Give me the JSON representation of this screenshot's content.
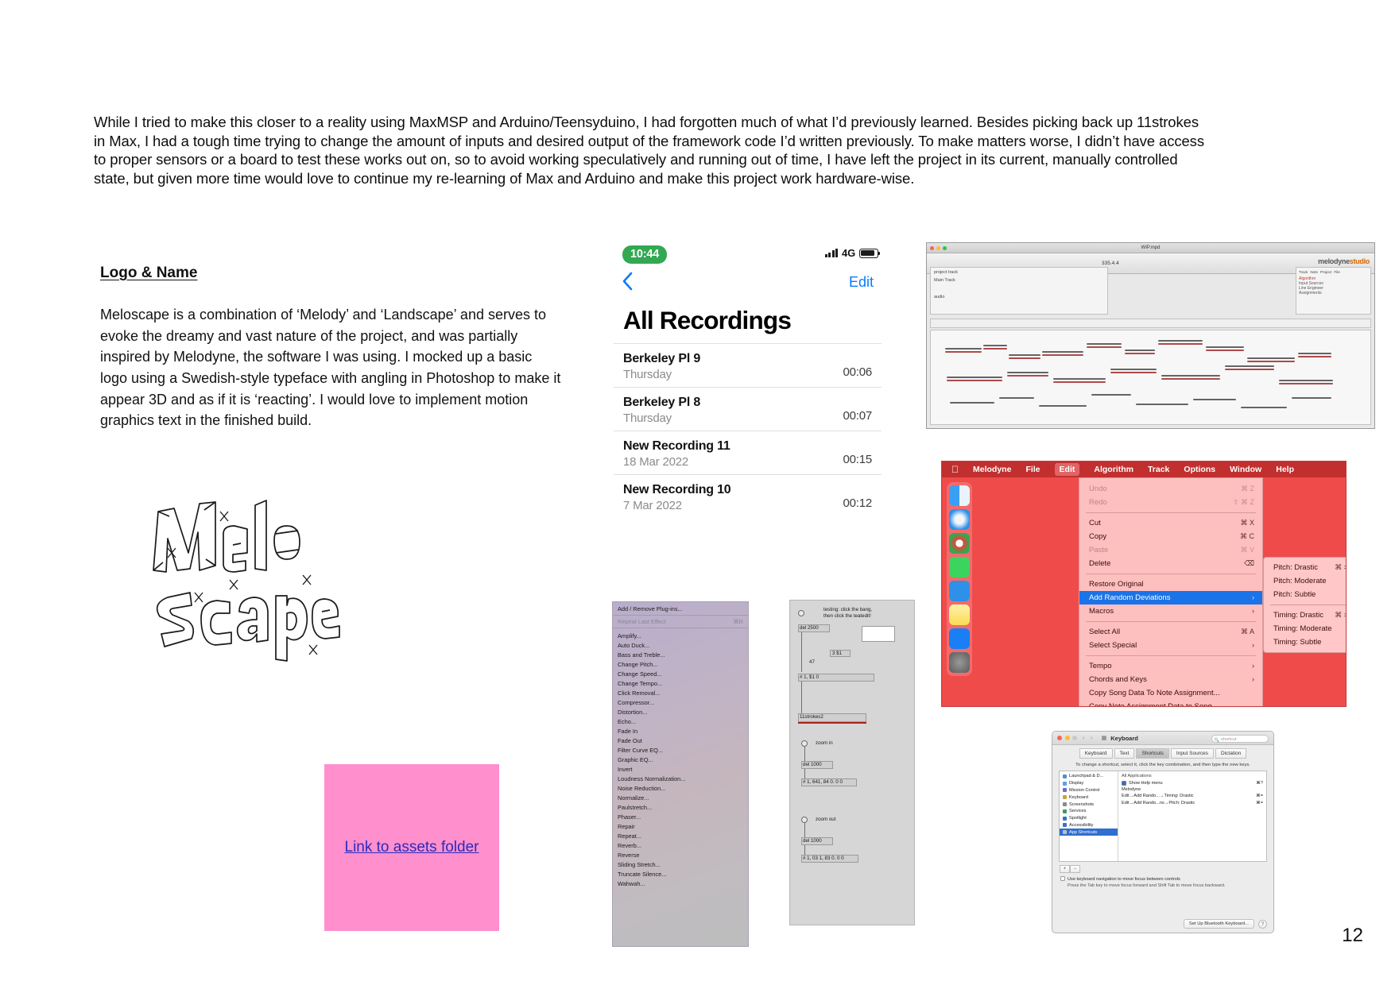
{
  "document": {
    "page_number": "12",
    "intro_paragraph": "While I tried to make this closer to a reality using MaxMSP and Arduino/Teensyduino, I had forgotten much of what I’d previously learned. Besides picking back up 11strokes in Max, I had a tough time trying to change the amount of inputs and desired output of the framework code I’d written previously. To make matters worse, I didn’t have access to proper sensors or a board to test these works out on, so to avoid working speculatively and running out of time, I have left the project in its current, manually controlled state, but given more time would love to continue my re-learning of Max and Arduino and make this project work hardware-wise."
  },
  "logo_section": {
    "heading": "Logo & Name",
    "body": "Meloscape is a combination of ‘Melody’ and ‘Landscape’ and serves to evoke the dreamy and vast nature of the project, and was partially inspired by Melodyne, the software I was using. I mocked up a basic logo using a Swedish-style typeface with angling in Photoshop to make it appear 3D and as if it is ‘reacting’. I would love to implement motion graphics text in the finished build.",
    "logo_wordmark_line1": "Melo",
    "logo_wordmark_line2": "Scape"
  },
  "assets_link": {
    "label_line1": "Link to assets",
    "label_line2": "folder",
    "background_color": "#ff8fcd",
    "text_color": "#2b2bbd"
  },
  "voice_memos": {
    "status": {
      "time": "10:44",
      "time_pill_color": "#33a852",
      "network": "4G"
    },
    "nav": {
      "back_icon": "chevron-left-icon",
      "edit_label": "Edit",
      "accent_color": "#0a7aff"
    },
    "title": "All Recordings",
    "recordings": [
      {
        "name": "Berkeley Pl 9",
        "date": "Thursday",
        "duration": "00:06"
      },
      {
        "name": "Berkeley Pl 8",
        "date": "Thursday",
        "duration": "00:07"
      },
      {
        "name": "New Recording 11",
        "date": "18 Mar 2022",
        "duration": "00:15"
      },
      {
        "name": "New Recording 10",
        "date": "7 Mar 2022",
        "duration": "00:12"
      }
    ]
  },
  "audacity_effects": {
    "header": "Add / Remove Plug-ins...",
    "repeat_item": "Repeat Last Effect",
    "repeat_shortcut": "⌘R",
    "items": [
      "Amplify...",
      "Auto Duck...",
      "Bass and Treble...",
      "Change Pitch...",
      "Change Speed...",
      "Change Tempo...",
      "Click Removal...",
      "Compressor...",
      "Distortion...",
      "Echo...",
      "Fade In",
      "Fade Out",
      "Filter Curve EQ...",
      "Graphic EQ...",
      "Invert",
      "Loudness Normalization...",
      "Noise Reduction...",
      "Normalize...",
      "Paulstretch...",
      "Phaser...",
      "Repair",
      "Repeat...",
      "Reverb...",
      "Reverse",
      "Sliding Stretch...",
      "Truncate Silence...",
      "Wahwah..."
    ]
  },
  "max_patch": {
    "comment_line1": "testing: click the bang,",
    "comment_line2": "then click the teatedit!",
    "objects": [
      "del 2500",
      "3 $1",
      "47",
      "# 1, $1 0",
      "11strokes2",
      "zoom in",
      "del 1000",
      "# 1, 641, 84 0. 0 0",
      "zoom out",
      "del 1000",
      "# 1, 03 1, 83 0. 0 0"
    ]
  },
  "melodyne_editor": {
    "window_title": "WIP.mpd",
    "brand": "melodyne",
    "brand_suffix": "studio",
    "tempo_value": "335.4.4",
    "panel_tabs": [
      "Track",
      "Note",
      "Project",
      "File"
    ],
    "left_labels": [
      "project track",
      "Main Track",
      "audio"
    ],
    "right_labels": [
      "Algorithm",
      "Input Sources",
      "Line Engineer",
      "Assignments"
    ]
  },
  "melodyne_menu": {
    "menubar": [
      "Melodyne",
      "File",
      "Edit",
      "Algorithm",
      "Track",
      "Options",
      "Window",
      "Help"
    ],
    "active_menu": "Edit",
    "apple_icon": "apple-logo-icon",
    "items": [
      {
        "label": "Undo",
        "shortcut": "⌘ Z",
        "state": "disabled"
      },
      {
        "label": "Redo",
        "shortcut": "⇧ ⌘ Z",
        "state": "disabled"
      },
      {
        "sep": true
      },
      {
        "label": "Cut",
        "shortcut": "⌘ X",
        "state": "normal"
      },
      {
        "label": "Copy",
        "shortcut": "⌘ C",
        "state": "normal"
      },
      {
        "label": "Paste",
        "shortcut": "⌘ V",
        "state": "disabled"
      },
      {
        "label": "Delete",
        "shortcut": "⌫",
        "state": "normal"
      },
      {
        "sep": true
      },
      {
        "label": "Restore Original",
        "shortcut": "",
        "state": "normal"
      },
      {
        "label": "Add Random Deviations",
        "shortcut": "›",
        "state": "selected"
      },
      {
        "label": "Macros",
        "shortcut": "›",
        "state": "normal"
      },
      {
        "sep": true
      },
      {
        "label": "Select All",
        "shortcut": "⌘ A",
        "state": "normal"
      },
      {
        "label": "Select Special",
        "shortcut": "›",
        "state": "normal"
      },
      {
        "sep": true
      },
      {
        "label": "Tempo",
        "shortcut": "›",
        "state": "normal"
      },
      {
        "label": "Chords and Keys",
        "shortcut": "›",
        "state": "normal"
      },
      {
        "label": "Copy Song Data To Note Assignment...",
        "shortcut": "",
        "state": "normal"
      },
      {
        "label": "Copy Note Assignment Data to Song",
        "shortcut": "",
        "state": "normal"
      }
    ],
    "submenu": [
      {
        "label": "Pitch: Drastic",
        "shortcut": "⌘ ="
      },
      {
        "label": "Pitch: Moderate",
        "shortcut": ""
      },
      {
        "label": "Pitch: Subtle",
        "shortcut": ""
      },
      {
        "sep": true
      },
      {
        "label": "Timing: Drastic",
        "shortcut": "⌘ ="
      },
      {
        "label": "Timing: Moderate",
        "shortcut": ""
      },
      {
        "label": "Timing: Subtle",
        "shortcut": ""
      }
    ],
    "dock_apps": [
      "Finder",
      "Safari",
      "Chrome",
      "Messages",
      "Mail",
      "Notes",
      "App Store",
      "System Preferences"
    ],
    "background_color": "#ef4b4b",
    "highlight_color": "#1a73e8"
  },
  "keyboard_prefs": {
    "window_title": "Keyboard",
    "search_placeholder": "shortcut",
    "tabs": [
      "Keyboard",
      "Text",
      "Shortcuts",
      "Input Sources",
      "Dictation"
    ],
    "active_tab": "Shortcuts",
    "instruction": "To change a shortcut, select it, click the key combination, and then type the new keys.",
    "categories": [
      "Launchpad & D...",
      "Display",
      "Mission Control",
      "Keyboard",
      "Screenshots",
      "Services",
      "Spotlight",
      "Accessibility",
      "App Shortcuts"
    ],
    "selected_category": "App Shortcuts",
    "right_header": "All Applications",
    "right_rows": [
      {
        "label": "Show Help menu",
        "shortcut": "⌘?"
      },
      {
        "label": "Melodyne",
        "shortcut": ""
      },
      {
        "label": "Edit→Add Rando...→Timing: Drastic",
        "shortcut": "⌘="
      },
      {
        "label": "Edit→Add Rando...ns→Pitch: Drastic",
        "shortcut": "⌘="
      }
    ],
    "add_remove": [
      "+",
      "−"
    ],
    "footer_checkbox": "Use keyboard navigation to move focus between controls",
    "footer_note": "Press the Tab key to move focus forward and Shift Tab to move focus backward.",
    "bottom_button": "Set Up Bluetooth Keyboard...",
    "help_icon": "question-mark-icon"
  }
}
